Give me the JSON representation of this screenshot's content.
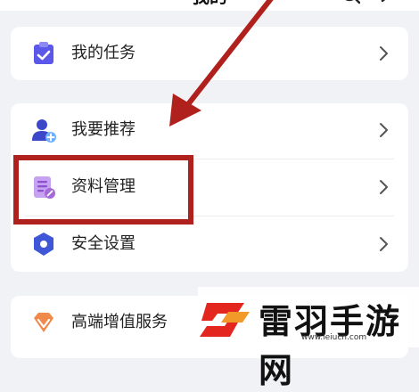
{
  "header": {
    "title": "我的"
  },
  "cards": {
    "tasks": {
      "label": "我的任务"
    },
    "recommend": {
      "label": "我要推荐"
    },
    "data": {
      "label": "资料管理"
    },
    "security": {
      "label": "安全设置"
    },
    "premium": {
      "label": "高端增值服务"
    }
  },
  "watermark": {
    "name": "雷羽手游网",
    "url": "www.leiucn.com"
  },
  "colors": {
    "annotation": "#b0211d",
    "tasks_icon": "#5b57e8",
    "recommend_icon": "#3d47c9",
    "data_icon": "#a46ad8",
    "security_icon": "#3f56d6",
    "premium_icon": "#f08a4b"
  }
}
